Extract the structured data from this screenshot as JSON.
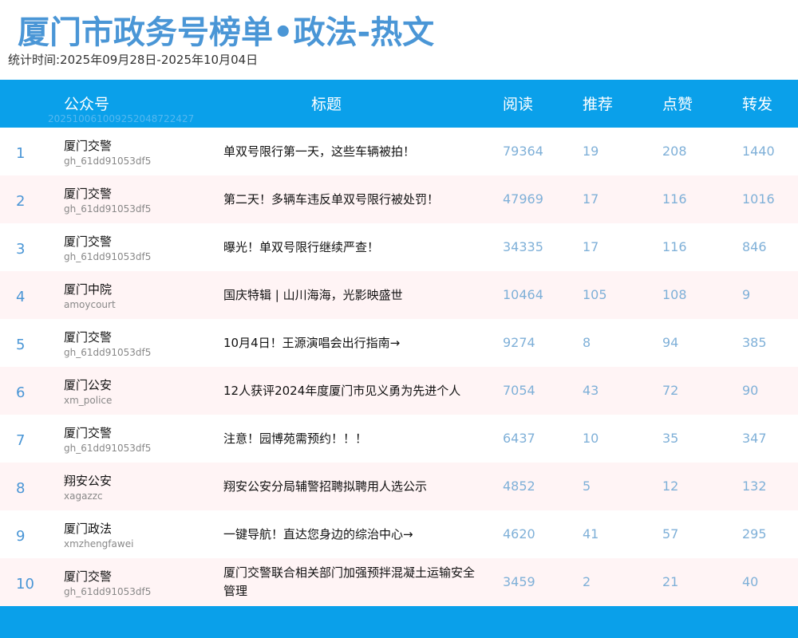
{
  "page": {
    "title": "厦门市政务号榜单•政法-热文",
    "period": "统计时间:2025年09月28日-2025年10月04日"
  },
  "header": {
    "account": "公众号",
    "title": "标题",
    "reads": "阅读",
    "recommends": "推荐",
    "likes": "点赞",
    "shares": "转发",
    "stamp": "20251006100925204872​2427"
  },
  "rows": [
    {
      "rank": "1",
      "account": "厦门交警",
      "id": "gh_61dd91053df5",
      "title": "单双号限行第一天，这些车辆被拍！",
      "reads": "79364",
      "recommends": "19",
      "likes": "208",
      "shares": "1440"
    },
    {
      "rank": "2",
      "account": "厦门交警",
      "id": "gh_61dd91053df5",
      "title": "第二天！多辆车违反单双号限行被处罚！",
      "reads": "47969",
      "recommends": "17",
      "likes": "116",
      "shares": "1016"
    },
    {
      "rank": "3",
      "account": "厦门交警",
      "id": "gh_61dd91053df5",
      "title": "曝光！单双号限行继续严查！",
      "reads": "34335",
      "recommends": "17",
      "likes": "116",
      "shares": "846"
    },
    {
      "rank": "4",
      "account": "厦门中院",
      "id": "amoycourt",
      "title": "国庆特辑 | 山川海海，光影映盛世",
      "reads": "10464",
      "recommends": "105",
      "likes": "108",
      "shares": "9"
    },
    {
      "rank": "5",
      "account": "厦门交警",
      "id": "gh_61dd91053df5",
      "title": "10月4日！王源演唱会出行指南→",
      "reads": "9274",
      "recommends": "8",
      "likes": "94",
      "shares": "385"
    },
    {
      "rank": "6",
      "account": "厦门公安",
      "id": "xm_police",
      "title": "12人获评2024年度厦门市见义勇为先进个人",
      "reads": "7054",
      "recommends": "43",
      "likes": "72",
      "shares": "90"
    },
    {
      "rank": "7",
      "account": "厦门交警",
      "id": "gh_61dd91053df5",
      "title": "注意！园博苑需预约！！！",
      "reads": "6437",
      "recommends": "10",
      "likes": "35",
      "shares": "347"
    },
    {
      "rank": "8",
      "account": "翔安公安",
      "id": "xagazzc",
      "title": "翔安公安分局辅警招聘拟聘用人选公示",
      "reads": "4852",
      "recommends": "5",
      "likes": "12",
      "shares": "132"
    },
    {
      "rank": "9",
      "account": "厦门政法",
      "id": "xmzhengfawei",
      "title": "一键导航！直达您身边的综治中心→",
      "reads": "4620",
      "recommends": "41",
      "likes": "57",
      "shares": "295"
    },
    {
      "rank": "10",
      "account": "厦门交警",
      "id": "gh_61dd91053df5",
      "title": "厦门交警联合相关部门加强预拌混凝土运输安全管理",
      "reads": "3459",
      "recommends": "2",
      "likes": "21",
      "shares": "40"
    }
  ]
}
